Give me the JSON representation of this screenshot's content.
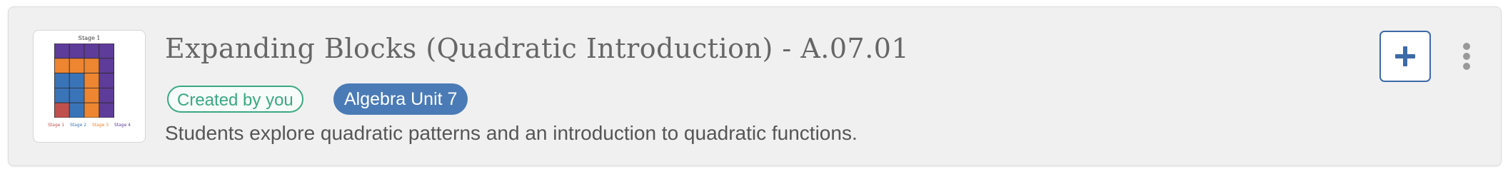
{
  "card": {
    "title": "Expanding Blocks (Quadratic Introduction) - A.07.01",
    "tags": {
      "created": "Created by you",
      "unit": "Algebra Unit 7"
    },
    "description": "Students explore quadratic patterns and an introduction to quadratic functions.",
    "thumbnail": {
      "title": "Stage 1",
      "legend": [
        "Stage 1",
        "Stage 2",
        "Stage 3",
        "Stage 4"
      ],
      "legend_colors": [
        "#c0504d",
        "#3a74b8",
        "#ee8530",
        "#5e3c99"
      ],
      "grid": [
        [
          "purple",
          "purple",
          "purple",
          "purple"
        ],
        [
          "orange",
          "orange",
          "orange",
          "purple"
        ],
        [
          "blue",
          "blue",
          "orange",
          "purple"
        ],
        [
          "blue",
          "blue",
          "orange",
          "purple"
        ],
        [
          "red",
          "blue",
          "orange",
          "purple"
        ]
      ]
    },
    "colors": {
      "created_tag": "#3aa981",
      "unit_tag": "#4a7bb6",
      "add_button": "#3d6aa8"
    },
    "actions": {
      "add_icon": "plus-icon",
      "more_icon": "vertical-ellipsis-icon"
    }
  }
}
